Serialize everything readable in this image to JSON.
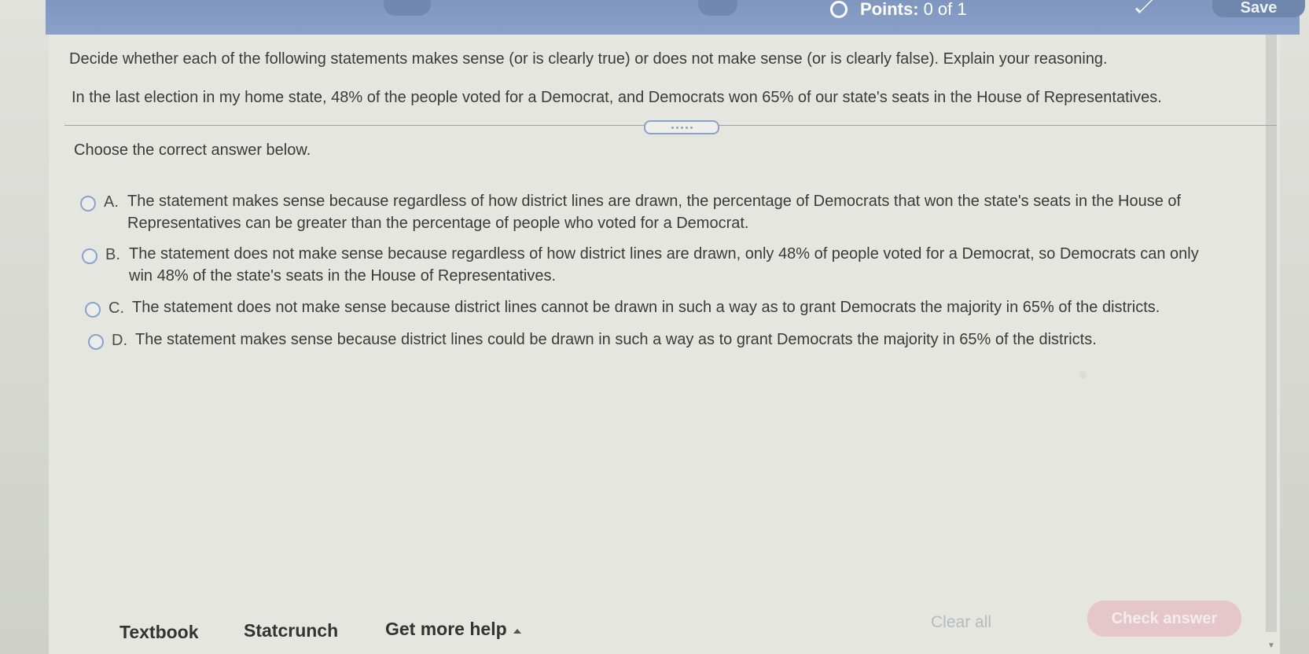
{
  "header": {
    "points_label": "Points:",
    "points_value": "0 of 1",
    "save_label": "Save"
  },
  "question": {
    "instructions": "Decide whether each of the following statements makes sense (or is clearly true) or does not make sense (or is clearly false). Explain your reasoning.",
    "statement": "In the last election in my home state, 48% of the people voted for a Democrat, and Democrats won 65% of our state's seats in the House of Representatives.",
    "prompt": "Choose the correct answer below."
  },
  "options": [
    {
      "letter": "A.",
      "text": "The statement makes sense because regardless of how district lines are drawn, the percentage of Democrats that won the state's seats in the House of\nRepresentatives can be greater than the percentage of people who voted for a Democrat."
    },
    {
      "letter": "B.",
      "text": "The statement does not make sense because regardless of how district lines are drawn, only 48% of people voted for a Democrat, so Democrats can only\nwin 48% of the state's seats in the House of Representatives."
    },
    {
      "letter": "C.",
      "text": "The statement does not make sense because district lines cannot be drawn in such a way as to grant Democrats the majority in 65% of the districts."
    },
    {
      "letter": "D.",
      "text": "The statement makes sense because district lines could be drawn in such a way as to grant Democrats the majority in 65% of the districts."
    }
  ],
  "footer": {
    "textbook_label": "Textbook",
    "statcrunch_label": "Statcrunch",
    "more_help_label": "Get more help",
    "clear_all_label": "Clear all",
    "check_answer_label": "Check answer"
  },
  "colors": {
    "header_blue": "#8aa2c9",
    "check_answer_bg": "#e4c6cb",
    "text": "#3a3a3a"
  }
}
